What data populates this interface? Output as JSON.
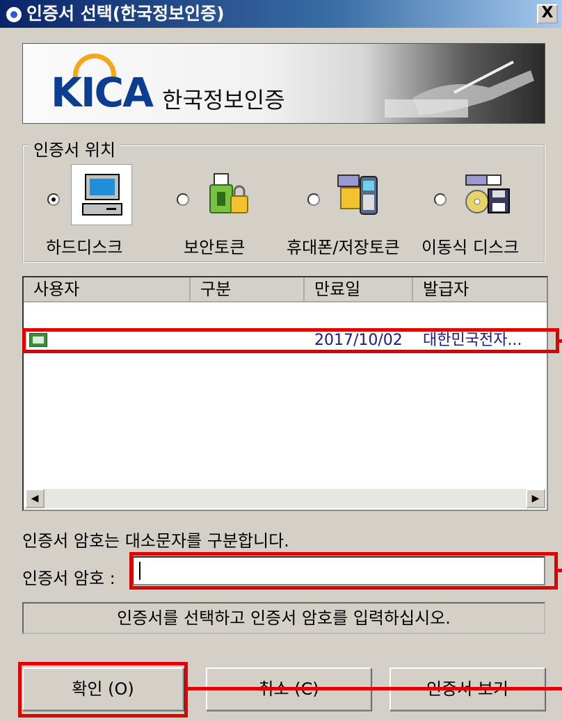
{
  "window": {
    "title": "인증서 선택(한국정보인증)",
    "close_label": "X"
  },
  "banner": {
    "logo_text": "KICA",
    "logo_subtitle": "한국정보인증"
  },
  "location": {
    "legend": "인증서 위치",
    "options": [
      {
        "label": "하드디스크",
        "icon": "computer-icon",
        "selected": true
      },
      {
        "label": "보안토큰",
        "icon": "security-token-icon",
        "selected": false
      },
      {
        "label": "휴대폰/저장토큰",
        "icon": "mobile-phone-icon",
        "selected": false
      },
      {
        "label": "이동식 디스크",
        "icon": "removable-disk-icon",
        "selected": false
      }
    ]
  },
  "cert_list": {
    "columns": [
      "사용자",
      "구분",
      "만료일",
      "발급자"
    ],
    "rows": [
      {
        "user": "",
        "type": "",
        "expiry": "2017/10/02",
        "issuer": "대한민국전자..."
      }
    ]
  },
  "password": {
    "hint": "인증서 암호는 대소문자를 구분합니다.",
    "label": "인증서 암호 :",
    "value": ""
  },
  "status_message": "인증서를 선택하고 인증서 암호를 입력하십시오.",
  "buttons": {
    "ok": "확인 (O)",
    "cancel": "취소 (C)",
    "view": "인증서 보기"
  },
  "colors": {
    "title_bar": "#0a246a",
    "annotation": "#e00000",
    "logo_blue": "#0b3d91",
    "logo_orange": "#f3a81b"
  }
}
